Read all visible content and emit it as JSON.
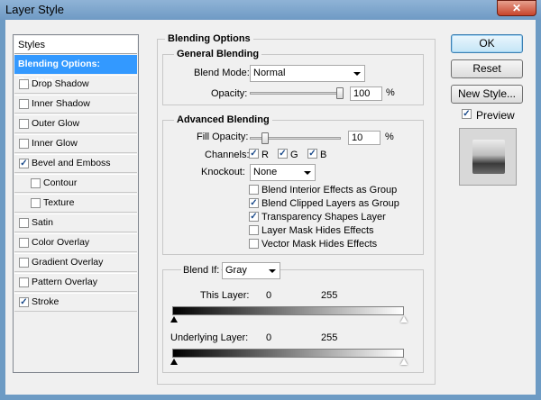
{
  "window": {
    "title": "Layer Style",
    "close_glyph": "✕"
  },
  "styles_panel": {
    "header": "Styles",
    "items": [
      {
        "label": "Blending Options: Custom",
        "active": true,
        "has_checkbox": false
      },
      {
        "label": "Drop Shadow",
        "checked": false
      },
      {
        "label": "Inner Shadow",
        "checked": false
      },
      {
        "label": "Outer Glow",
        "checked": false
      },
      {
        "label": "Inner Glow",
        "checked": false
      },
      {
        "label": "Bevel and Emboss",
        "checked": true
      },
      {
        "label": "Contour",
        "checked": false,
        "indent": true
      },
      {
        "label": "Texture",
        "checked": false,
        "indent": true
      },
      {
        "label": "Satin",
        "checked": false
      },
      {
        "label": "Color Overlay",
        "checked": false
      },
      {
        "label": "Gradient Overlay",
        "checked": false
      },
      {
        "label": "Pattern Overlay",
        "checked": false
      },
      {
        "label": "Stroke",
        "checked": true
      }
    ]
  },
  "blending_options": {
    "title": "Blending Options",
    "general": {
      "title": "General Blending",
      "blend_mode_label": "Blend Mode:",
      "blend_mode_value": "Normal",
      "opacity_label": "Opacity:",
      "opacity_value": "100",
      "opacity_unit": "%",
      "opacity_fraction": 1.0
    },
    "advanced": {
      "title": "Advanced Blending",
      "fill_opacity_label": "Fill Opacity:",
      "fill_opacity_value": "10",
      "fill_opacity_unit": "%",
      "fill_opacity_fraction": 0.1,
      "channels_label": "Channels:",
      "channels": [
        {
          "label": "R",
          "checked": true
        },
        {
          "label": "G",
          "checked": true
        },
        {
          "label": "B",
          "checked": true
        }
      ],
      "knockout_label": "Knockout:",
      "knockout_value": "None",
      "options": [
        {
          "label": "Blend Interior Effects as Group",
          "checked": false
        },
        {
          "label": "Blend Clipped Layers as Group",
          "checked": true
        },
        {
          "label": "Transparency Shapes Layer",
          "checked": true
        },
        {
          "label": "Layer Mask Hides Effects",
          "checked": false
        },
        {
          "label": "Vector Mask Hides Effects",
          "checked": false
        }
      ]
    },
    "blend_if": {
      "label": "Blend If:",
      "value": "Gray",
      "this_layer_label": "This Layer:",
      "this_layer_min": "0",
      "this_layer_max": "255",
      "underlying_label": "Underlying Layer:",
      "underlying_min": "0",
      "underlying_max": "255"
    }
  },
  "buttons": {
    "ok": "OK",
    "reset": "Reset",
    "new_style": "New Style..."
  },
  "preview": {
    "label": "Preview",
    "checked": true
  },
  "check_glyph": "✓",
  "colors": {
    "accent": "#3399ff",
    "titlebar": "#6d9bc4",
    "close": "#c7442b"
  }
}
